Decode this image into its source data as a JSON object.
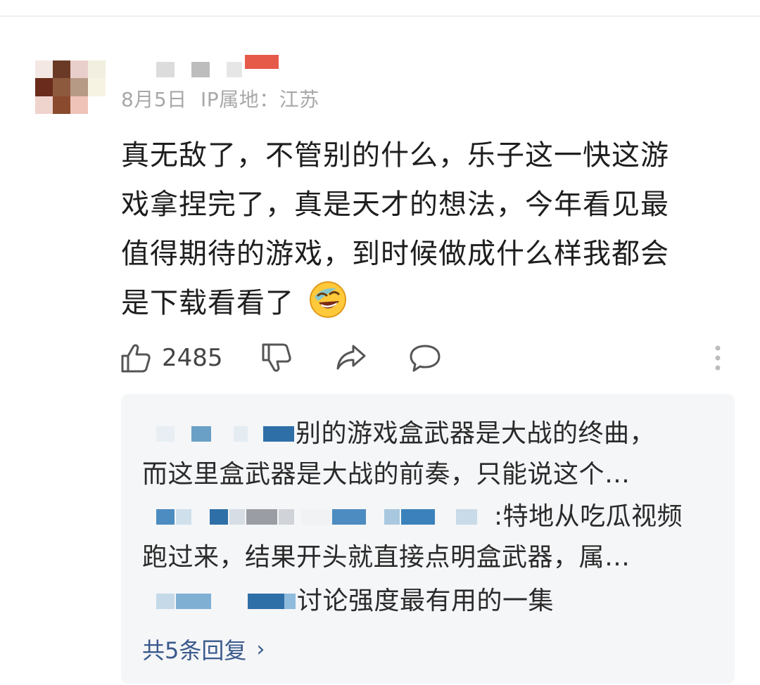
{
  "comment": {
    "date": "8月5日",
    "ip_location": "IP属地：江苏",
    "lines": [
      "真无敌了，不管别的什么，乐子这一快这游",
      "戏拿捏完了，真是天才的想法，今年看见最",
      "值得期待的游戏，到时候做成什么样我都会",
      "是下载看看了"
    ],
    "emoji": "laughing-crying-emoji"
  },
  "actions": {
    "like_count": "2485",
    "icons": [
      "thumbs-up-icon",
      "thumbs-down-icon",
      "share-icon",
      "comment-icon",
      "more-icon"
    ]
  },
  "replies": {
    "items": [
      {
        "text_line1": "别的游戏盒武器是大战的终曲，",
        "text_line2": "而这里盒武器是大战的前奏，只能说这个…"
      },
      {
        "text_line1": ":特地从吃瓜视频",
        "text_line2": "跑过来，结果开头就直接点明盒武器，属…"
      },
      {
        "text_line1": "讨论强度最有用的一集"
      }
    ],
    "more_label": "共5条回复",
    "more_chevron": "›"
  },
  "colors": {
    "text_primary": "#1e1e1e",
    "meta_gray": "#a8a8a8",
    "reply_bg": "#f5f6f8",
    "link_blue": "#3a5a8c"
  }
}
